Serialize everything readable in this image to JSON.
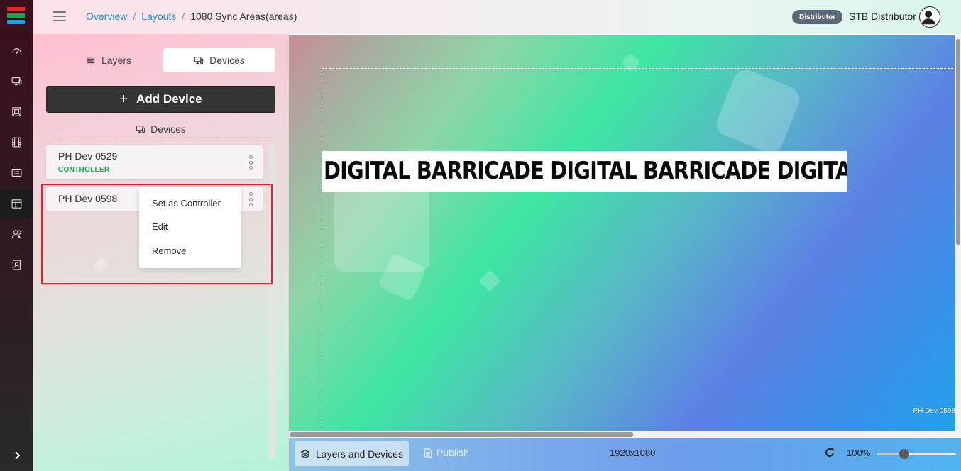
{
  "app": {
    "logo_colors": [
      "#e4232b",
      "#1ca34a",
      "#1e9ee6"
    ]
  },
  "rail": {
    "items": [
      {
        "icon": "dashboard-icon"
      },
      {
        "icon": "monitor-icon"
      },
      {
        "icon": "image-gallery-icon"
      },
      {
        "icon": "film-icon"
      },
      {
        "icon": "playlist-icon"
      },
      {
        "icon": "layout-icon",
        "active": true
      },
      {
        "icon": "users-icon"
      },
      {
        "icon": "report-icon"
      }
    ],
    "expand_icon": "chevron-right-icon"
  },
  "header": {
    "breadcrumb": {
      "overview": "Overview",
      "layouts": "Layouts",
      "current": "1080 Sync Areas(areas)",
      "separator": "/"
    },
    "role_badge": "Distributor",
    "user_name": "STB Distributor"
  },
  "panel": {
    "tabs": {
      "layers": "Layers",
      "devices": "Devices"
    },
    "add_device_label": "Add Device",
    "section_title": "Devices",
    "devices": [
      {
        "name": "PH Dev 0529",
        "tag": "CONTROLLER"
      },
      {
        "name": "PH Dev 0598",
        "tag": ""
      }
    ],
    "context_menu": {
      "set_controller": "Set as Controller",
      "edit": "Edit",
      "remove": "Remove"
    }
  },
  "canvas": {
    "ticker_text": "DIGITAL BARRICADE DIGITAL BARRICADE DIGITAL BARRICADE",
    "device_label": "PH Dev 0598"
  },
  "footer": {
    "layers_devices_label": "Layers and Devices",
    "publish_label": "Publish",
    "resolution": "1920x1080",
    "zoom_label": "100%",
    "zoom_level": 0.35
  }
}
